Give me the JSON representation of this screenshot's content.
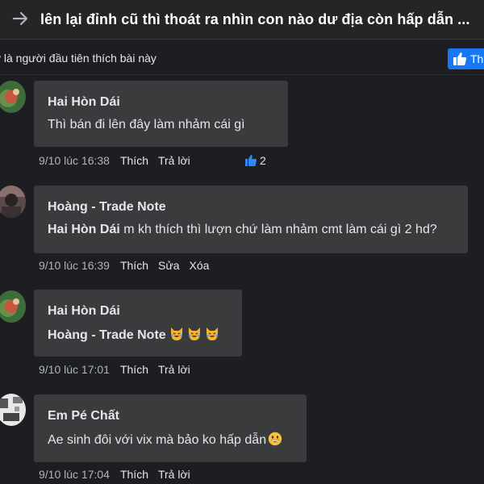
{
  "header": {
    "title": "lên lại đỉnh cũ thì thoát ra nhìn con nào dư địa còn hấp dẫn ..."
  },
  "likes_bar": {
    "first_like_text": "y là người đầu tiên thích bài này",
    "like_page_button": "Th"
  },
  "comments": [
    {
      "author": "Hai Hòn Dái",
      "text": "Thì bán đi lên đây làm nhảm cái gì",
      "timestamp": "9/10 lúc 16:38",
      "actions": [
        "Thích",
        "Trả lời"
      ],
      "reaction_count": "2"
    },
    {
      "author": "Hoàng - Trade Note",
      "mention": "Hai Hòn Dái",
      "text": " m kh thích thì lượn chứ làm nhảm cmt làm cái gì 2 hd?",
      "timestamp": "9/10 lúc 16:39",
      "actions": [
        "Thích",
        "Sửa",
        "Xóa"
      ]
    },
    {
      "author": "Hai Hòn Dái",
      "mention": "Hoàng - Trade Note",
      "emoji": "crying-laughing-cat ×3",
      "timestamp": "9/10 lúc 17:01",
      "actions": [
        "Thích",
        "Trả lời"
      ]
    },
    {
      "author": "Em Pé Chất",
      "text": "Ae sinh đôi với vix mà bảo ko hấp dẫn",
      "emoji": "grinning-face",
      "timestamp": "9/10 lúc 17:04",
      "actions": [
        "Thích",
        "Trả lời"
      ]
    }
  ],
  "colors": {
    "background": "#1c1e21",
    "bubble": "#3a3b3c",
    "accent": "#1877f2",
    "muted_text": "#b0b3b8"
  },
  "icons": [
    "back-arrow-icon",
    "thumbs-up-icon",
    "like-reaction-icon",
    "cat-emoji-icon",
    "grin-emoji-icon"
  ]
}
